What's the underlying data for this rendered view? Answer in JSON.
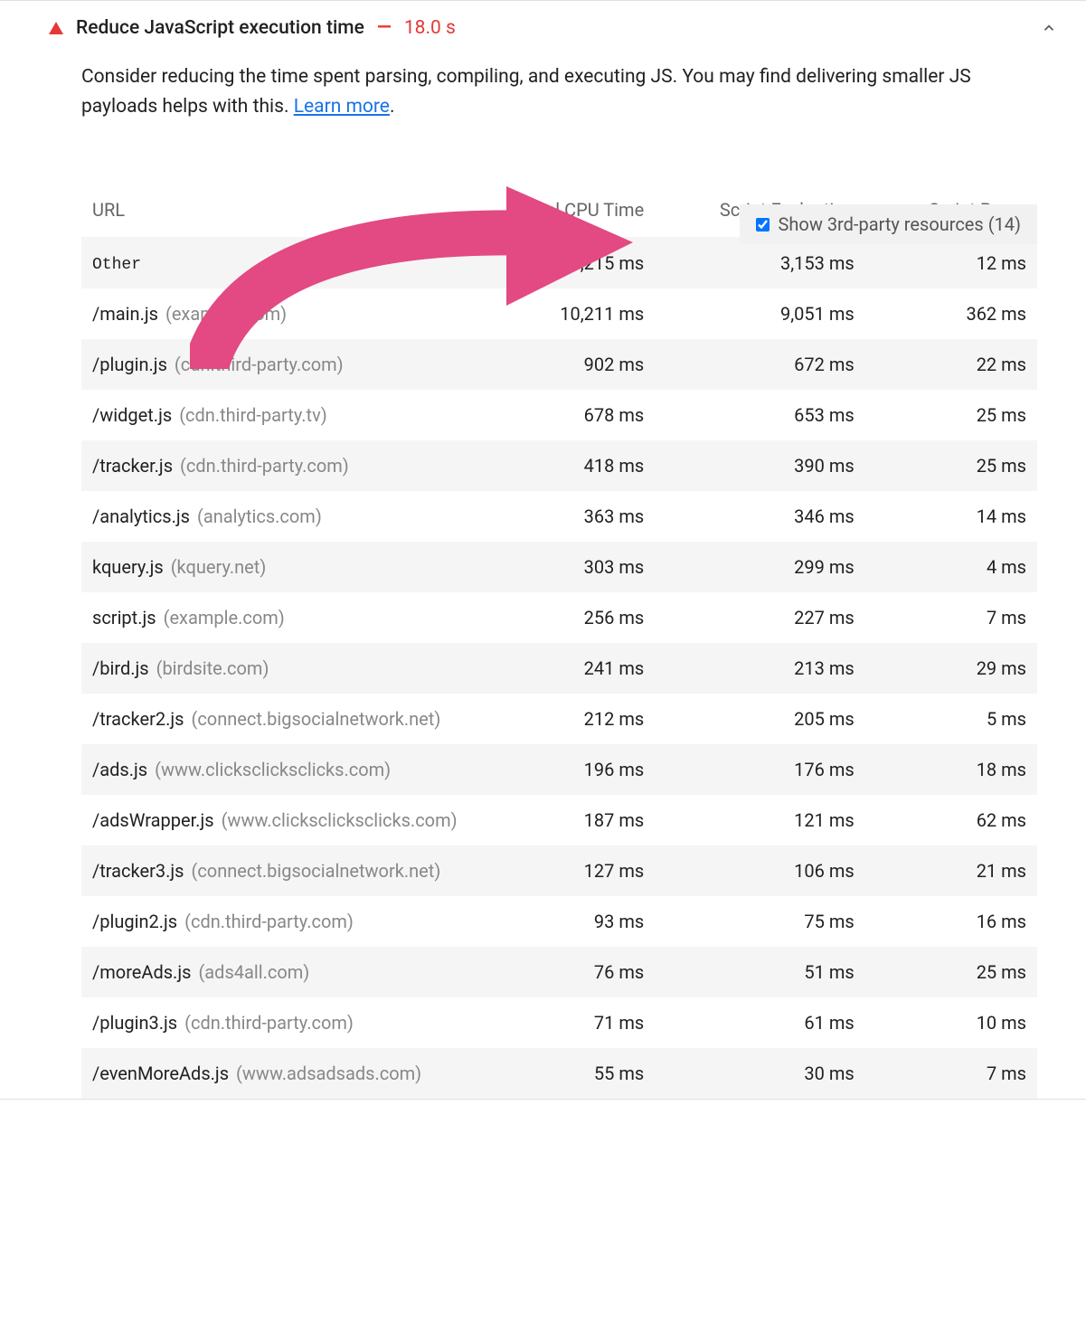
{
  "audit": {
    "title": "Reduce JavaScript execution time",
    "metric": "18.0 s",
    "description": "Consider reducing the time spent parsing, compiling, and executing JS. You may find delivering smaller JS payloads helps with this. ",
    "learn_more": "Learn more",
    "expanded": true
  },
  "third_party_toggle": {
    "label": "Show 3rd-party resources (14)",
    "checked": true
  },
  "table": {
    "headers": {
      "url": "URL",
      "cpu": "Total CPU Time",
      "eval": "Script Evaluation",
      "parse": "Script Parse"
    },
    "rows": [
      {
        "file": "Other",
        "host": "",
        "cpu": "11,215 ms",
        "eval": "3,153 ms",
        "parse": "12 ms",
        "other": true
      },
      {
        "file": "/main.js",
        "host": "(example.com)",
        "cpu": "10,211 ms",
        "eval": "9,051 ms",
        "parse": "362 ms"
      },
      {
        "file": "/plugin.js",
        "host": "(cdn.third-party.com)",
        "cpu": "902 ms",
        "eval": "672 ms",
        "parse": "22 ms"
      },
      {
        "file": "/widget.js",
        "host": "(cdn.third-party.tv)",
        "cpu": "678 ms",
        "eval": "653 ms",
        "parse": "25 ms"
      },
      {
        "file": "/tracker.js",
        "host": "(cdn.third-party.com)",
        "cpu": "418 ms",
        "eval": "390 ms",
        "parse": "25 ms"
      },
      {
        "file": "/analytics.js",
        "host": "(analytics.com)",
        "cpu": "363 ms",
        "eval": "346 ms",
        "parse": "14 ms"
      },
      {
        "file": "kquery.js",
        "host": "(kquery.net)",
        "cpu": "303 ms",
        "eval": "299 ms",
        "parse": "4 ms"
      },
      {
        "file": "script.js",
        "host": "(example.com)",
        "cpu": "256 ms",
        "eval": "227 ms",
        "parse": "7 ms"
      },
      {
        "file": "/bird.js",
        "host": "(birdsite.com)",
        "cpu": "241 ms",
        "eval": "213 ms",
        "parse": "29 ms"
      },
      {
        "file": "/tracker2.js",
        "host": "(connect.bigsocialnetwork.net)",
        "cpu": "212 ms",
        "eval": "205 ms",
        "parse": "5 ms"
      },
      {
        "file": "/ads.js",
        "host": "(www.clicksclicksclicks.com)",
        "cpu": "196 ms",
        "eval": "176 ms",
        "parse": "18 ms"
      },
      {
        "file": "/adsWrapper.js",
        "host": "(www.clicksclicksclicks.com)",
        "cpu": "187 ms",
        "eval": "121 ms",
        "parse": "62 ms"
      },
      {
        "file": "/tracker3.js",
        "host": "(connect.bigsocialnetwork.net)",
        "cpu": "127 ms",
        "eval": "106 ms",
        "parse": "21 ms"
      },
      {
        "file": "/plugin2.js",
        "host": "(cdn.third-party.com)",
        "cpu": "93 ms",
        "eval": "75 ms",
        "parse": "16 ms"
      },
      {
        "file": "/moreAds.js",
        "host": "(ads4all.com)",
        "cpu": "76 ms",
        "eval": "51 ms",
        "parse": "25 ms"
      },
      {
        "file": "/plugin3.js",
        "host": "(cdn.third-party.com)",
        "cpu": "71 ms",
        "eval": "61 ms",
        "parse": "10 ms"
      },
      {
        "file": "/evenMoreAds.js",
        "host": "(www.adsadsads.com)",
        "cpu": "55 ms",
        "eval": "30 ms",
        "parse": "7 ms"
      }
    ]
  }
}
